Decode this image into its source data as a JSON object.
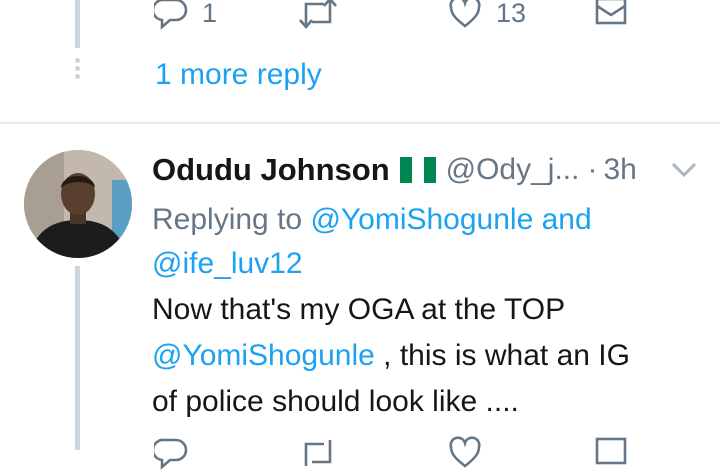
{
  "previous_tweet": {
    "reply_count": "1",
    "retweet_count": "",
    "like_count": "13"
  },
  "more_replies_label": "1 more reply",
  "tweet": {
    "author_name": "Odudu Johnson",
    "author_handle": "@Ody_j...",
    "separator": "·",
    "time": "3h",
    "replying_prefix": "Replying to",
    "replying_to_1": "@YomiShogunle",
    "replying_and": "and",
    "replying_to_2": "@ife_luv12",
    "text_line_1": "Now that's my OGA at the TOP",
    "text_mention": "@YomiShogunle",
    "text_line_2_rest": " , this is what an IG",
    "text_line_3": "of police should look like ...."
  },
  "colors": {
    "accent": "#1da1f2",
    "secondary_text": "#657786",
    "thread_line": "#ccd6dd",
    "flag_green": "#008751"
  },
  "icons": [
    "reply-icon",
    "retweet-icon",
    "like-icon",
    "dm-icon",
    "chevron-down-icon",
    "nigeria-flag-icon"
  ]
}
